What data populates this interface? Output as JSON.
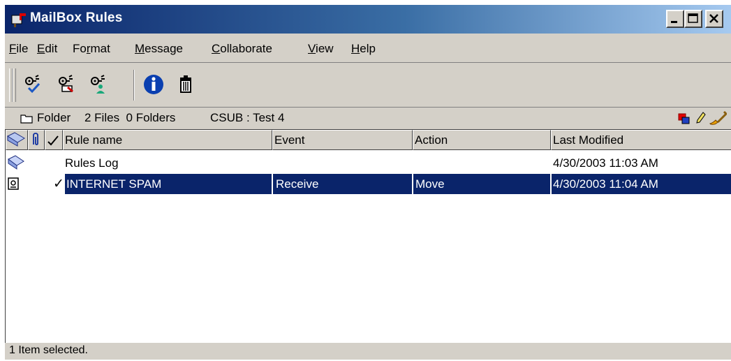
{
  "window": {
    "title": "MailBox Rules"
  },
  "title_buttons": [
    "minimize",
    "maximize",
    "close"
  ],
  "menu": [
    {
      "label": "File",
      "accel": "F",
      "rest": "ile"
    },
    {
      "label": "Edit",
      "accel": "E",
      "rest": "dit"
    },
    {
      "label": "Format",
      "pre": "Fo",
      "accel": "r",
      "rest": "mat"
    },
    {
      "label": "Message",
      "accel": "M",
      "rest": "essage"
    },
    {
      "label": "Collaborate",
      "accel": "C",
      "rest": "ollaborate"
    },
    {
      "label": "View",
      "accel": "V",
      "rest": "iew"
    },
    {
      "label": "Help",
      "accel": "H",
      "rest": "elp"
    }
  ],
  "toolbar": {
    "tools": [
      "new-rule-icon",
      "edit-rule-icon",
      "delete-rule-icon",
      "info-icon",
      "trash-icon"
    ]
  },
  "pathbar": {
    "folder_label": "Folder",
    "counts": "2 Files  0 Folders",
    "location": "CSUB : Test 4"
  },
  "columns": {
    "rule_name": "Rule name",
    "event": "Event",
    "action": "Action",
    "last_modified": "Last Modified"
  },
  "rows": [
    {
      "name": "Rules Log",
      "event": "",
      "action": "",
      "modified": "4/30/2003  11:03 AM",
      "enabled": "",
      "selected": false
    },
    {
      "name": "INTERNET SPAM",
      "event": "Receive",
      "action": "Move",
      "modified": "4/30/2003  11:04 AM",
      "enabled": "✓",
      "selected": true
    }
  ],
  "status": {
    "text": "1 Item selected."
  },
  "colors": {
    "selection": "#0a246a",
    "titlebar_start": "#0a246a",
    "titlebar_end": "#a6caf0",
    "chrome": "#d4d0c8"
  }
}
